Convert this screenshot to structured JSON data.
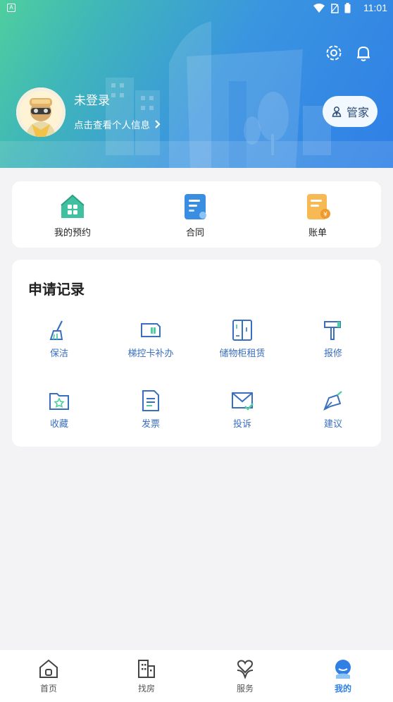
{
  "status_bar": {
    "left_badge": "A",
    "time": "11:01"
  },
  "header": {
    "user_name": "未登录",
    "user_sub": "点击查看个人信息",
    "manager_label": "管家",
    "icons": [
      "settings-icon",
      "bell-icon"
    ]
  },
  "quick_actions": [
    {
      "label": "我的预约",
      "icon": "house-icon"
    },
    {
      "label": "合同",
      "icon": "contract-icon"
    },
    {
      "label": "账单",
      "icon": "bill-icon"
    }
  ],
  "apply": {
    "title": "申请记录",
    "items": [
      {
        "label": "保洁",
        "icon": "broom-icon"
      },
      {
        "label": "梯控卡补办",
        "icon": "card-icon"
      },
      {
        "label": "储物柜租赁",
        "icon": "locker-icon"
      },
      {
        "label": "报修",
        "icon": "hammer-icon"
      },
      {
        "label": "收藏",
        "icon": "folder-star-icon"
      },
      {
        "label": "发票",
        "icon": "document-icon"
      },
      {
        "label": "投诉",
        "icon": "mail-check-icon"
      },
      {
        "label": "建议",
        "icon": "pen-icon"
      }
    ]
  },
  "tabbar": {
    "items": [
      {
        "label": "首页",
        "icon": "home-icon"
      },
      {
        "label": "找房",
        "icon": "building-icon"
      },
      {
        "label": "服务",
        "icon": "service-heart-icon"
      },
      {
        "label": "我的",
        "icon": "profile-icon"
      }
    ],
    "active_index": 3
  },
  "colors": {
    "accent": "#2f7fe6",
    "label_blue": "#3a6fbf",
    "background": "#f3f3f5"
  }
}
